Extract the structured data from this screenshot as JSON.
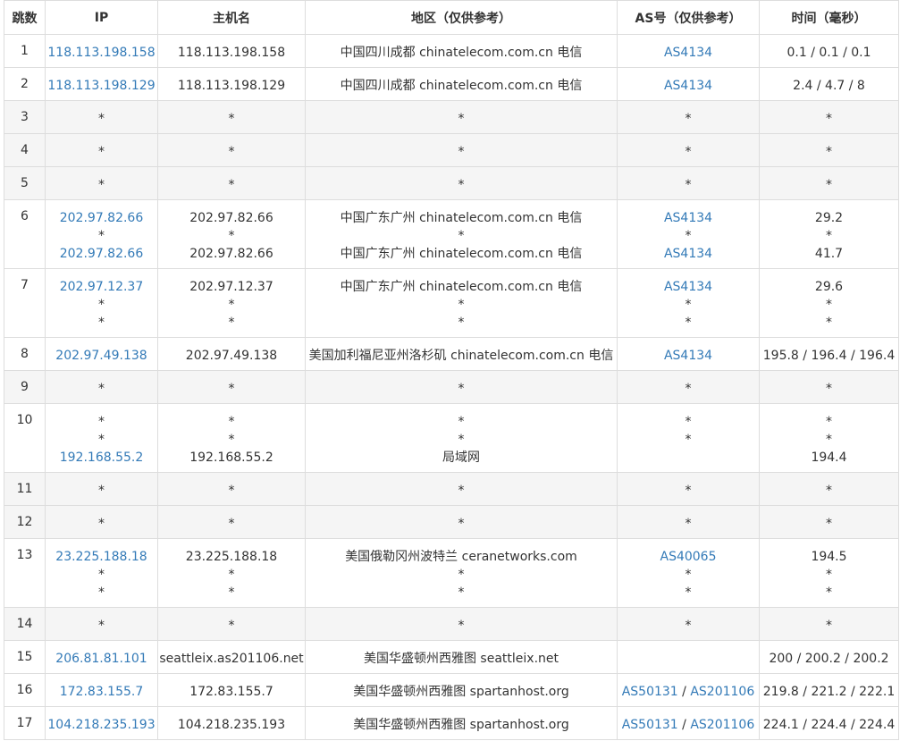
{
  "headers": {
    "hop": "跳数",
    "ip": "IP",
    "host": "主机名",
    "region": "地区（仅供参考）",
    "as": "AS号（仅供参考）",
    "time": "时间（毫秒）"
  },
  "colors": {
    "link": "#337ab7",
    "text": "#333333",
    "border": "#dddddd",
    "stripe": "#f5f5f5"
  },
  "rows": [
    {
      "hop": "1",
      "lines": [
        {
          "ip": "118.113.198.158",
          "host": "118.113.198.158",
          "region": "中国四川成都 chinatelecom.com.cn 电信",
          "as": [
            "AS4134"
          ],
          "time": "0.1 / 0.1 / 0.1"
        }
      ]
    },
    {
      "hop": "2",
      "lines": [
        {
          "ip": "118.113.198.129",
          "host": "118.113.198.129",
          "region": "中国四川成都 chinatelecom.com.cn 电信",
          "as": [
            "AS4134"
          ],
          "time": "2.4 / 4.7 / 8"
        }
      ]
    },
    {
      "hop": "3",
      "lines": [
        {
          "ip": "*",
          "host": "*",
          "region": "*",
          "as": [
            "*"
          ],
          "time": "*"
        }
      ]
    },
    {
      "hop": "4",
      "lines": [
        {
          "ip": "*",
          "host": "*",
          "region": "*",
          "as": [
            "*"
          ],
          "time": "*"
        }
      ]
    },
    {
      "hop": "5",
      "lines": [
        {
          "ip": "*",
          "host": "*",
          "region": "*",
          "as": [
            "*"
          ],
          "time": "*"
        }
      ]
    },
    {
      "hop": "6",
      "lines": [
        {
          "ip": "202.97.82.66",
          "host": "202.97.82.66",
          "region": "中国广东广州 chinatelecom.com.cn 电信",
          "as": [
            "AS4134"
          ],
          "time": "29.2"
        },
        {
          "ip": "*",
          "host": "*",
          "region": "*",
          "as": [
            "*"
          ],
          "time": "*"
        },
        {
          "ip": "202.97.82.66",
          "host": "202.97.82.66",
          "region": "中国广东广州 chinatelecom.com.cn 电信",
          "as": [
            "AS4134"
          ],
          "time": "41.7"
        }
      ]
    },
    {
      "hop": "7",
      "lines": [
        {
          "ip": "202.97.12.37",
          "host": "202.97.12.37",
          "region": "中国广东广州 chinatelecom.com.cn 电信",
          "as": [
            "AS4134"
          ],
          "time": "29.6"
        },
        {
          "ip": "*",
          "host": "*",
          "region": "*",
          "as": [
            "*"
          ],
          "time": "*"
        },
        {
          "ip": "*",
          "host": "*",
          "region": "*",
          "as": [
            "*"
          ],
          "time": "*"
        }
      ]
    },
    {
      "hop": "8",
      "lines": [
        {
          "ip": "202.97.49.138",
          "host": "202.97.49.138",
          "region": "美国加利福尼亚州洛杉矶 chinatelecom.com.cn 电信",
          "as": [
            "AS4134"
          ],
          "time": "195.8 / 196.4 / 196.4"
        }
      ]
    },
    {
      "hop": "9",
      "lines": [
        {
          "ip": "*",
          "host": "*",
          "region": "*",
          "as": [
            "*"
          ],
          "time": "*"
        }
      ]
    },
    {
      "hop": "10",
      "lines": [
        {
          "ip": "*",
          "host": "*",
          "region": "*",
          "as": [
            "*"
          ],
          "time": "*"
        },
        {
          "ip": "*",
          "host": "*",
          "region": "*",
          "as": [
            "*"
          ],
          "time": "*"
        },
        {
          "ip": "192.168.55.2",
          "host": "192.168.55.2",
          "region": "局域网",
          "as": [],
          "time": "194.4"
        }
      ]
    },
    {
      "hop": "11",
      "lines": [
        {
          "ip": "*",
          "host": "*",
          "region": "*",
          "as": [
            "*"
          ],
          "time": "*"
        }
      ]
    },
    {
      "hop": "12",
      "lines": [
        {
          "ip": "*",
          "host": "*",
          "region": "*",
          "as": [
            "*"
          ],
          "time": "*"
        }
      ]
    },
    {
      "hop": "13",
      "lines": [
        {
          "ip": "23.225.188.18",
          "host": "23.225.188.18",
          "region": "美国俄勒冈州波特兰 ceranetworks.com",
          "as": [
            "AS40065"
          ],
          "time": "194.5"
        },
        {
          "ip": "*",
          "host": "*",
          "region": "*",
          "as": [
            "*"
          ],
          "time": "*"
        },
        {
          "ip": "*",
          "host": "*",
          "region": "*",
          "as": [
            "*"
          ],
          "time": "*"
        }
      ]
    },
    {
      "hop": "14",
      "lines": [
        {
          "ip": "*",
          "host": "*",
          "region": "*",
          "as": [
            "*"
          ],
          "time": "*"
        }
      ]
    },
    {
      "hop": "15",
      "lines": [
        {
          "ip": "206.81.81.101",
          "host": "seattleix.as201106.net",
          "region": "美国华盛顿州西雅图 seattleix.net",
          "as": [],
          "time": "200 / 200.2 / 200.2"
        }
      ]
    },
    {
      "hop": "16",
      "lines": [
        {
          "ip": "172.83.155.7",
          "host": "172.83.155.7",
          "region": "美国华盛顿州西雅图 spartanhost.org",
          "as": [
            "AS50131",
            "AS201106"
          ],
          "time": "219.8 / 221.2 / 222.1"
        }
      ]
    },
    {
      "hop": "17",
      "lines": [
        {
          "ip": "104.218.235.193",
          "host": "104.218.235.193",
          "region": "美国华盛顿州西雅图 spartanhost.org",
          "as": [
            "AS50131",
            "AS201106"
          ],
          "time": "224.1 / 224.4 / 224.4"
        }
      ]
    }
  ]
}
